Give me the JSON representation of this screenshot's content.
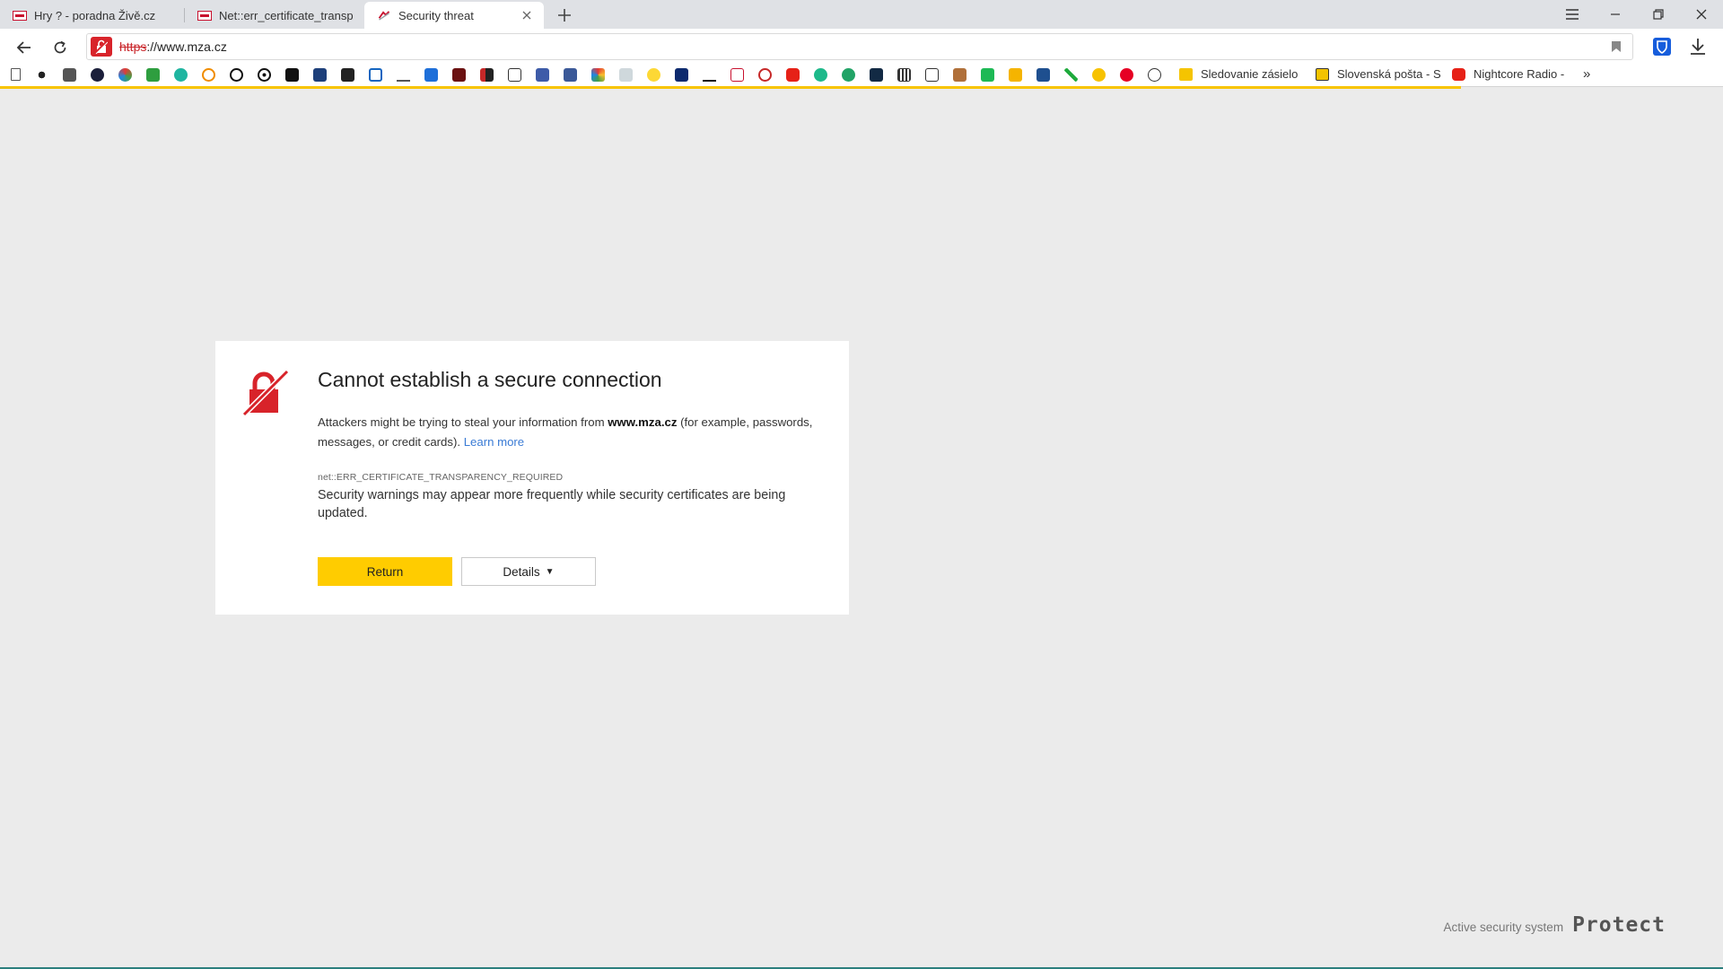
{
  "tabs": [
    {
      "label": "Hry ? - poradna Živě.cz",
      "favicon": "zive-icon",
      "active": false
    },
    {
      "label": "Net::err_certificate_transpar",
      "favicon": "zive-icon",
      "active": false
    },
    {
      "label": "Security threat",
      "favicon": "warning-icon",
      "active": true
    }
  ],
  "address": {
    "scheme": "https",
    "rest": "://www.mza.cz"
  },
  "bookmarks": {
    "links": [
      {
        "label": "Sledovanie zásielo"
      },
      {
        "label": "Slovenská pošta - S"
      },
      {
        "label": "Nightcore Radio -"
      }
    ],
    "more_label": "»"
  },
  "error": {
    "title": "Cannot establish a secure connection",
    "desc_pre": "Attackers might be trying to steal your information from ",
    "domain": "www.mza.cz",
    "desc_post": " (for example, passwords, messages, or credit cards). ",
    "learn_more": "Learn more",
    "code": "net::ERR_CERTIFICATE_TRANSPARENCY_REQUIRED",
    "warning": "Security warnings may appear more frequently while security certificates are being updated.",
    "return_label": "Return",
    "details_label": "Details",
    "details_caret": "▼"
  },
  "footer": {
    "small": "Active security system",
    "brand": "Protect"
  },
  "colors": {
    "accent_yellow": "#ffcc00",
    "danger_red": "#d8232a",
    "link_blue": "#3a7bd5"
  }
}
